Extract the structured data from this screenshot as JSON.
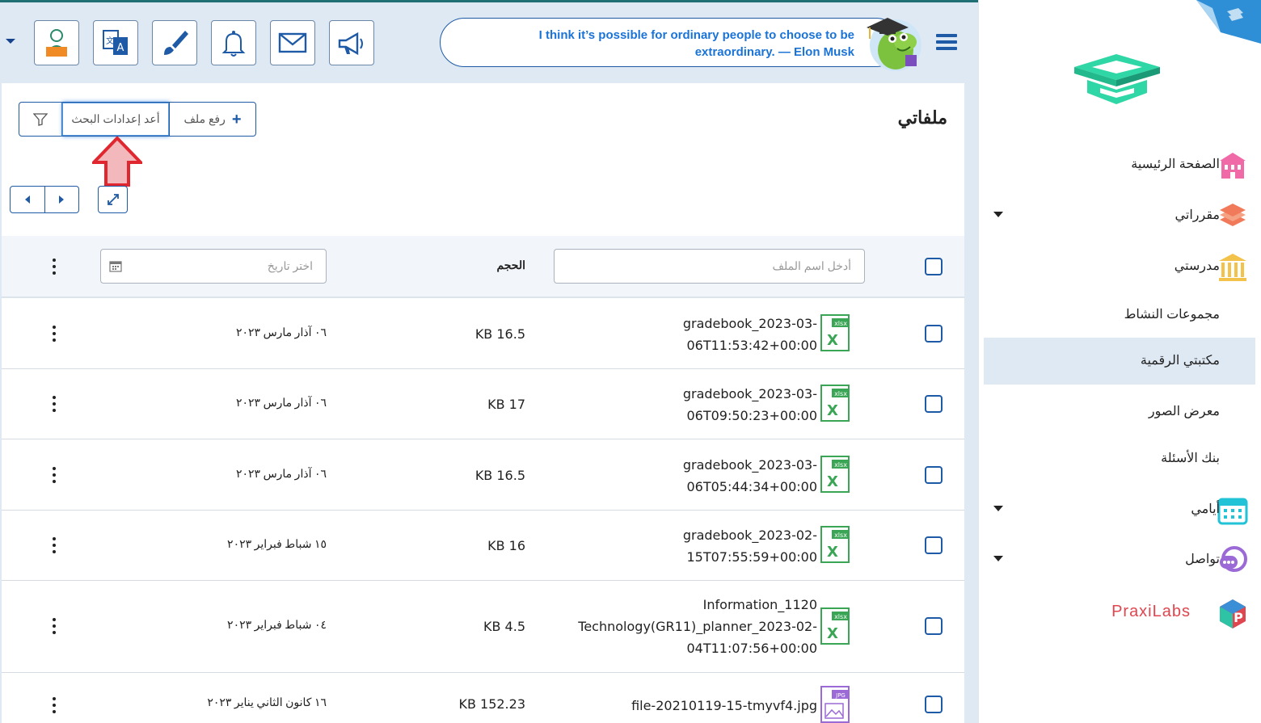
{
  "header": {
    "quote": "I think it’s possible for ordinary people to choose to be extraordinary. — Elon Musk",
    "buttons": [
      "profile-icon",
      "translate-icon",
      "brush-icon",
      "bell-icon",
      "mail-icon",
      "megaphone-icon"
    ]
  },
  "page": {
    "title": "ملفاتي",
    "upload_label": "رفع ملف",
    "reset_label": "أعد إعدادات البحث"
  },
  "table": {
    "name_placeholder": "أدخل اسم الملف",
    "size_header": "الحجم",
    "date_placeholder": "اختر تاريخ",
    "rows": [
      {
        "name_line1": "gradebook_2023-03-",
        "name_line2": "06T11:53:42+00:00",
        "name_line3": "",
        "size": "KB 16.5",
        "date": "٠٦ آذار مارس ٢٠٢٣",
        "type": "xlsx"
      },
      {
        "name_line1": "gradebook_2023-03-",
        "name_line2": "06T09:50:23+00:00",
        "name_line3": "",
        "size": "KB 17",
        "date": "٠٦ آذار مارس ٢٠٢٣",
        "type": "xlsx"
      },
      {
        "name_line1": "gradebook_2023-03-",
        "name_line2": "06T05:44:34+00:00",
        "name_line3": "",
        "size": "KB 16.5",
        "date": "٠٦ آذار مارس ٢٠٢٣",
        "type": "xlsx"
      },
      {
        "name_line1": "gradebook_2023-02-",
        "name_line2": "15T07:55:59+00:00",
        "name_line3": "",
        "size": "KB 16",
        "date": "١٥ شباط فبراير ٢٠٢٣",
        "type": "xlsx"
      },
      {
        "name_line1": "Information_1120",
        "name_line2": "Technology(GR11)_planner_2023-02-",
        "name_line3": "04T11:07:56+00:00",
        "size": "KB 4.5",
        "date": "٠٤ شباط فبراير ٢٠٢٣",
        "type": "xlsx"
      },
      {
        "name_line1": "file-20210119-15-tmyvf4.jpg",
        "name_line2": "",
        "name_line3": "",
        "size": "KB 152.23",
        "date": "١٦ كانون الثاني يناير ٢٠٢٣",
        "type": "jpg"
      }
    ]
  },
  "sidebar": {
    "items": [
      {
        "label": "الصفحة الرئيسية",
        "icon": "school-building-icon"
      },
      {
        "label": "مقرراتي",
        "icon": "books-icon"
      },
      {
        "label": "مدرستي",
        "icon": "institution-icon"
      },
      {
        "label": "مجموعات النشاط",
        "icon": ""
      },
      {
        "label": "مكتبتي الرقمية",
        "icon": ""
      },
      {
        "label": "معرض الصور",
        "icon": ""
      },
      {
        "label": "بنك الأسئلة",
        "icon": ""
      },
      {
        "label": "أيامي",
        "icon": "calendar-icon"
      },
      {
        "label": "تواصل",
        "icon": "chat-icon"
      },
      {
        "label": "PraxiLabs",
        "icon": "praxilabs-logo-icon"
      }
    ]
  },
  "icon_labels": {
    "xlsx": "xlsx",
    "jpg": "JPG"
  },
  "colors": {
    "primary": "#1e5aa6",
    "header_bg": "#dfe9f4",
    "quote_text": "#1a73d6",
    "excel_green": "#3aa655",
    "annotation_red": "#e0262e"
  }
}
